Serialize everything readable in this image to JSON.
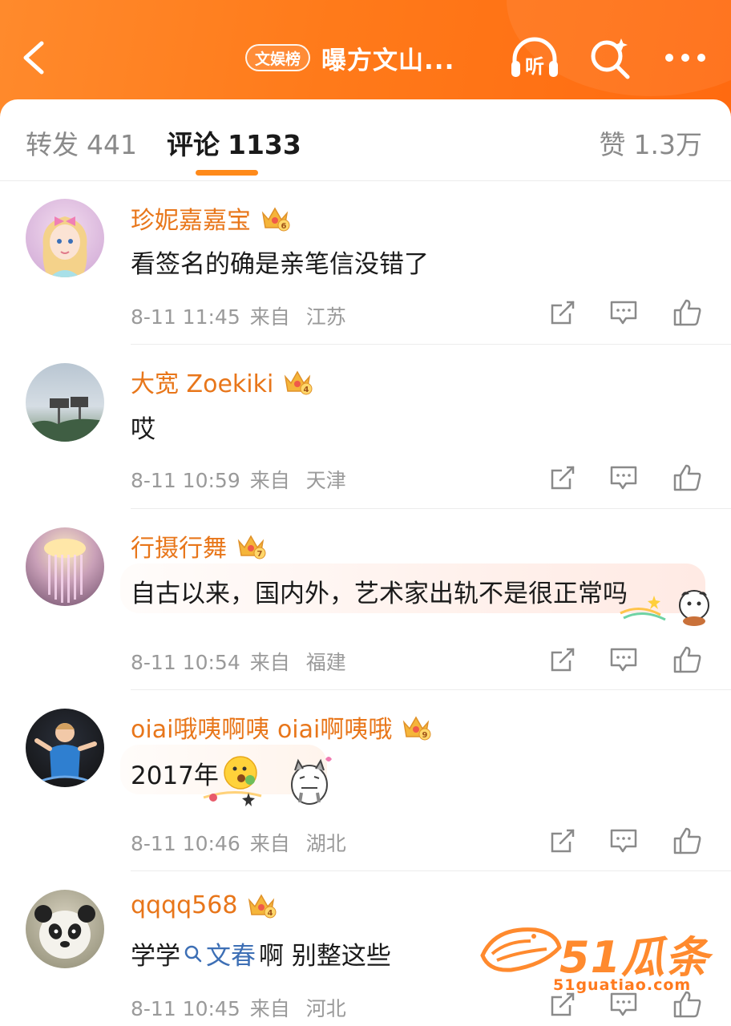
{
  "header": {
    "rank_badge": "文娱榜",
    "title": "曝方文山...",
    "listen_label": "听"
  },
  "tabs": [
    {
      "label": "转发",
      "count": "441"
    },
    {
      "label": "评论",
      "count": "1133"
    },
    {
      "label": "赞",
      "count": "1.3万"
    }
  ],
  "comments": [
    {
      "user": "珍妮嘉嘉宝",
      "level": "6",
      "text": "看签名的确是亲笔信没错了",
      "time": "8-11 11:45",
      "from": "来自",
      "location": "江苏"
    },
    {
      "user": "大宽 Zoekiki",
      "level": "4",
      "text": "哎",
      "time": "8-11 10:59",
      "from": "来自",
      "location": "天津"
    },
    {
      "user": "行摄行舞",
      "level": "7",
      "text": "自古以来，国内外，艺术家出轨不是很正常吗",
      "time": "8-11 10:54",
      "from": "来自",
      "location": "福建"
    },
    {
      "user": "oiai哦咦啊咦 oiai啊咦哦",
      "level": "9",
      "text": "2017年",
      "time": "8-11 10:46",
      "from": "来自",
      "location": "湖北"
    },
    {
      "user": "qqqq568",
      "level": "4",
      "text_before": "学学",
      "topic": "文春",
      "text_after": "啊 别整这些",
      "time": "8-11 10:45",
      "from": "来自",
      "location": "河北"
    }
  ],
  "watermark": {
    "brand": "51瓜条",
    "url": "51guatiao.com"
  },
  "colors": {
    "header_orange": "#ff7a1a",
    "username": "#e8761a",
    "topic_link": "#3d6fb5",
    "indicator": "#ff8a1a"
  }
}
